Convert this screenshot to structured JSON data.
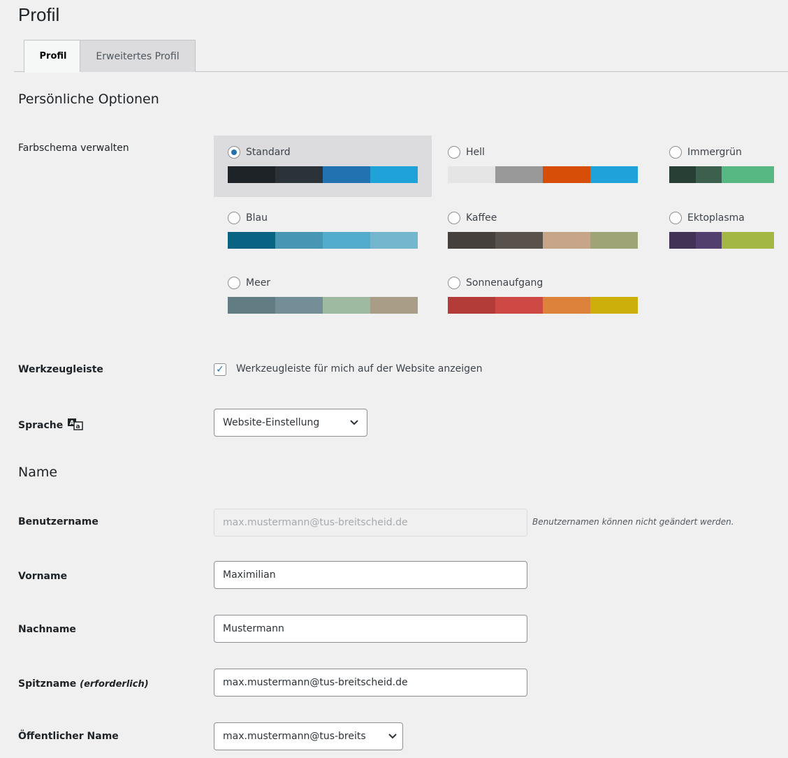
{
  "page": {
    "title": "Profil"
  },
  "tabs": [
    {
      "label": "Profil",
      "active": true
    },
    {
      "label": "Erweitertes Profil",
      "active": false
    }
  ],
  "personal_options": {
    "heading": "Persönliche Optionen",
    "color_scheme": {
      "label": "Farbschema verwalten",
      "selected": "Standard",
      "schemes": [
        {
          "name": "Standard",
          "colors": [
            "#1d2327",
            "#2c3338",
            "#2271b1",
            "#1ea2d8"
          ]
        },
        {
          "name": "Hell",
          "colors": [
            "#e5e5e5",
            "#999999",
            "#d64e07",
            "#1ea2d8"
          ]
        },
        {
          "name": "Immergrün",
          "colors": [
            "#273f35",
            "#3d5f4e",
            "#58b883",
            "#58b883"
          ]
        },
        {
          "name": "Blau",
          "colors": [
            "#096484",
            "#4796b3",
            "#52accc",
            "#74b6ce"
          ]
        },
        {
          "name": "Kaffee",
          "colors": [
            "#46403c",
            "#59524c",
            "#c7a589",
            "#9ea476"
          ]
        },
        {
          "name": "Ektoplasma",
          "colors": [
            "#413256",
            "#523f6d",
            "#a3b745",
            "#a3b745"
          ]
        },
        {
          "name": "Meer",
          "colors": [
            "#627c83",
            "#738e96",
            "#9ebaa0",
            "#aa9d88"
          ]
        },
        {
          "name": "Sonnenaufgang",
          "colors": [
            "#b43c38",
            "#cf4944",
            "#dd823b",
            "#ccaf0b"
          ]
        }
      ]
    },
    "toolbar": {
      "label": "Werkzeugleiste",
      "checkbox_label": "Werkzeugleiste für mich auf der Website anzeigen",
      "checked": true
    },
    "language": {
      "label": "Sprache",
      "value": "Website-Einstellung"
    }
  },
  "name_section": {
    "heading": "Name",
    "username": {
      "label": "Benutzername",
      "value": "max.mustermann@tus-breitscheid.de",
      "hint": "Benutzernamen können nicht geändert werden."
    },
    "first_name": {
      "label": "Vorname",
      "value": "Maximilian"
    },
    "last_name": {
      "label": "Nachname",
      "value": "Mustermann"
    },
    "nickname": {
      "label": "Spitzname",
      "label_suffix": "(erforderlich)",
      "value": "max.mustermann@tus-breitscheid.de"
    },
    "display_name": {
      "label": "Öffentlicher Name",
      "value": "max.mustermann@tus-breits"
    }
  },
  "icons": {
    "language": "translate-icon",
    "dropdown": "chevron-down-icon",
    "checkmark": "checkmark-icon"
  }
}
